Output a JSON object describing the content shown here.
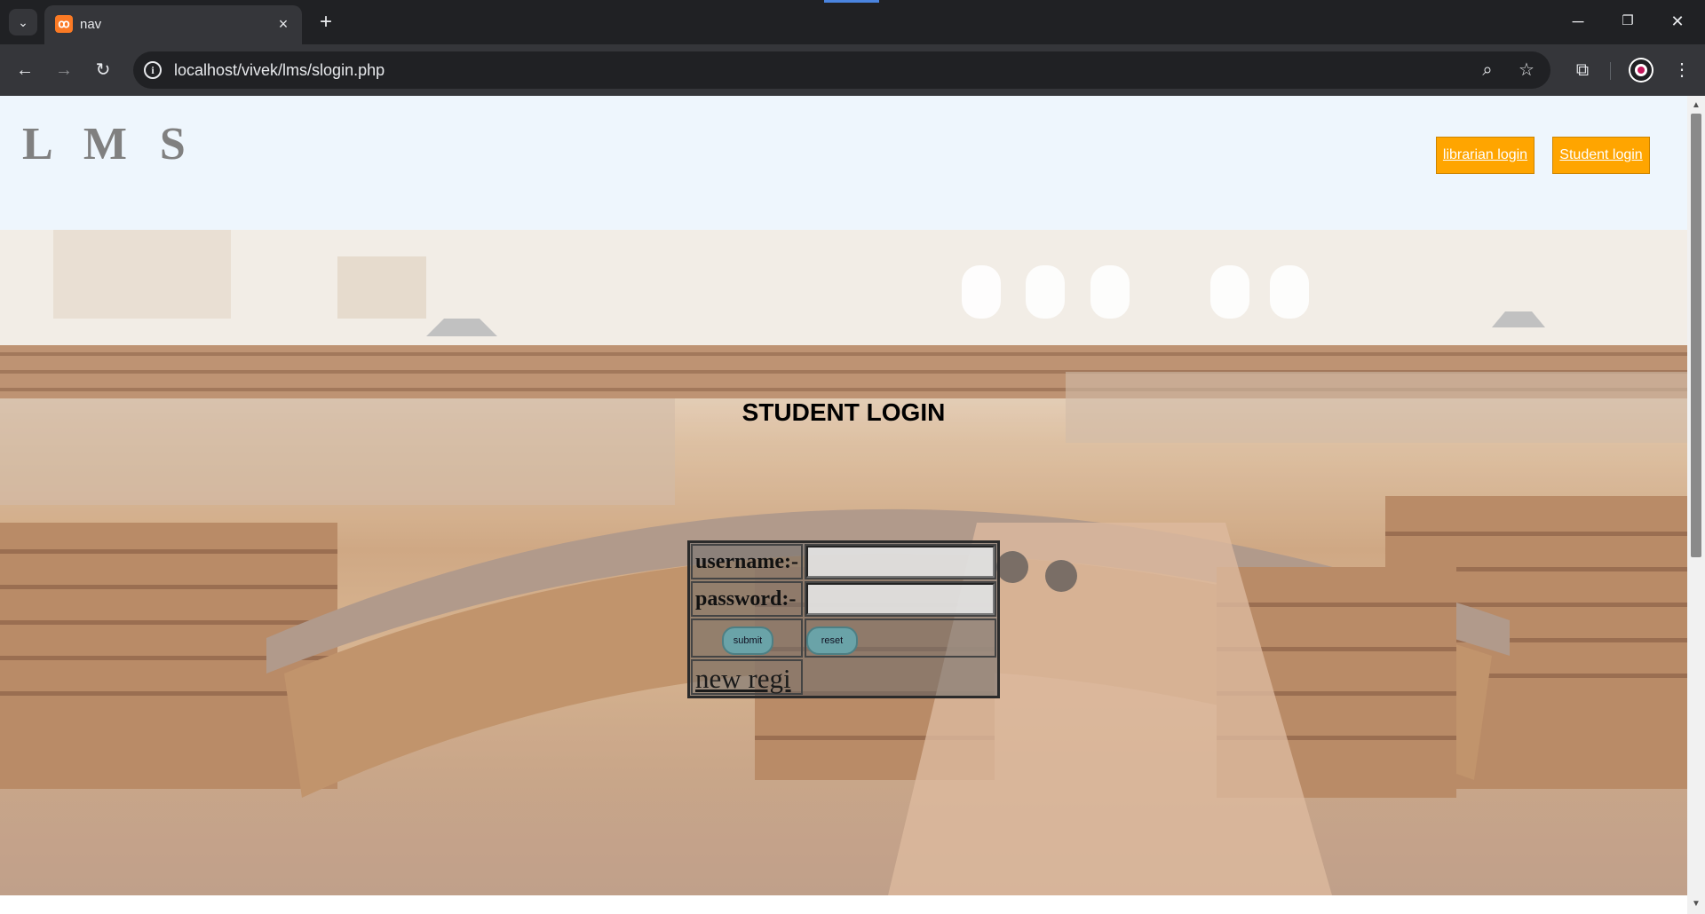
{
  "browser": {
    "tab_title": "nav",
    "url": "localhost/vivek/lms/slogin.php",
    "new_tab_symbol": "+",
    "close_symbol": "×"
  },
  "header": {
    "logo": "L M S",
    "librarian_login": "librarian login",
    "student_login": "Student login"
  },
  "login": {
    "title": "STUDENT LOGIN",
    "username_label": "username:-",
    "username_value": "",
    "password_label": "password:-",
    "password_value": "",
    "submit_label": "submit",
    "reset_label": "reset",
    "register_link": "new regi"
  },
  "colors": {
    "nav_button_bg": "#ffa500",
    "header_bg": "#eef6fd",
    "button_bg": "#6aa3a8"
  }
}
